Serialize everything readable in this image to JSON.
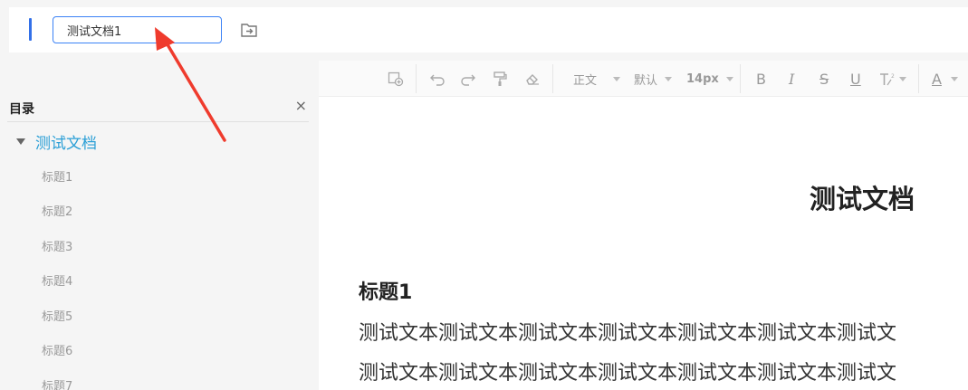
{
  "header": {
    "doc_name_value": "测试文档1"
  },
  "sidebar": {
    "title": "目录",
    "close_glyph": "×",
    "root": "测试文档",
    "items": [
      "标题1",
      "标题2",
      "标题3",
      "标题4",
      "标题5",
      "标题6",
      "标题7"
    ]
  },
  "toolbar": {
    "paragraph": "正文",
    "font": "默认",
    "size": "14px",
    "bold": "B",
    "italic": "I",
    "strike": "S",
    "underline": "U",
    "color": "A"
  },
  "document": {
    "title": "测试文档",
    "heading1": "标题1",
    "para_line1": "测试文本测试文本测试文本测试文本测试文本测试文本测试文",
    "para_line2": "测试文本测试文本测试文本测试文本测试文本测试文本测试文"
  },
  "colors": {
    "accent": "#3370e8",
    "toc_active": "#2b9fd6",
    "annotation_arrow": "#ef3b2d"
  },
  "icons": [
    "export-icon",
    "close-icon",
    "caret-down-icon",
    "insert-icon",
    "undo-icon",
    "redo-icon",
    "format-painter-icon",
    "eraser-icon",
    "superscript-icon",
    "annotation-arrow"
  ]
}
